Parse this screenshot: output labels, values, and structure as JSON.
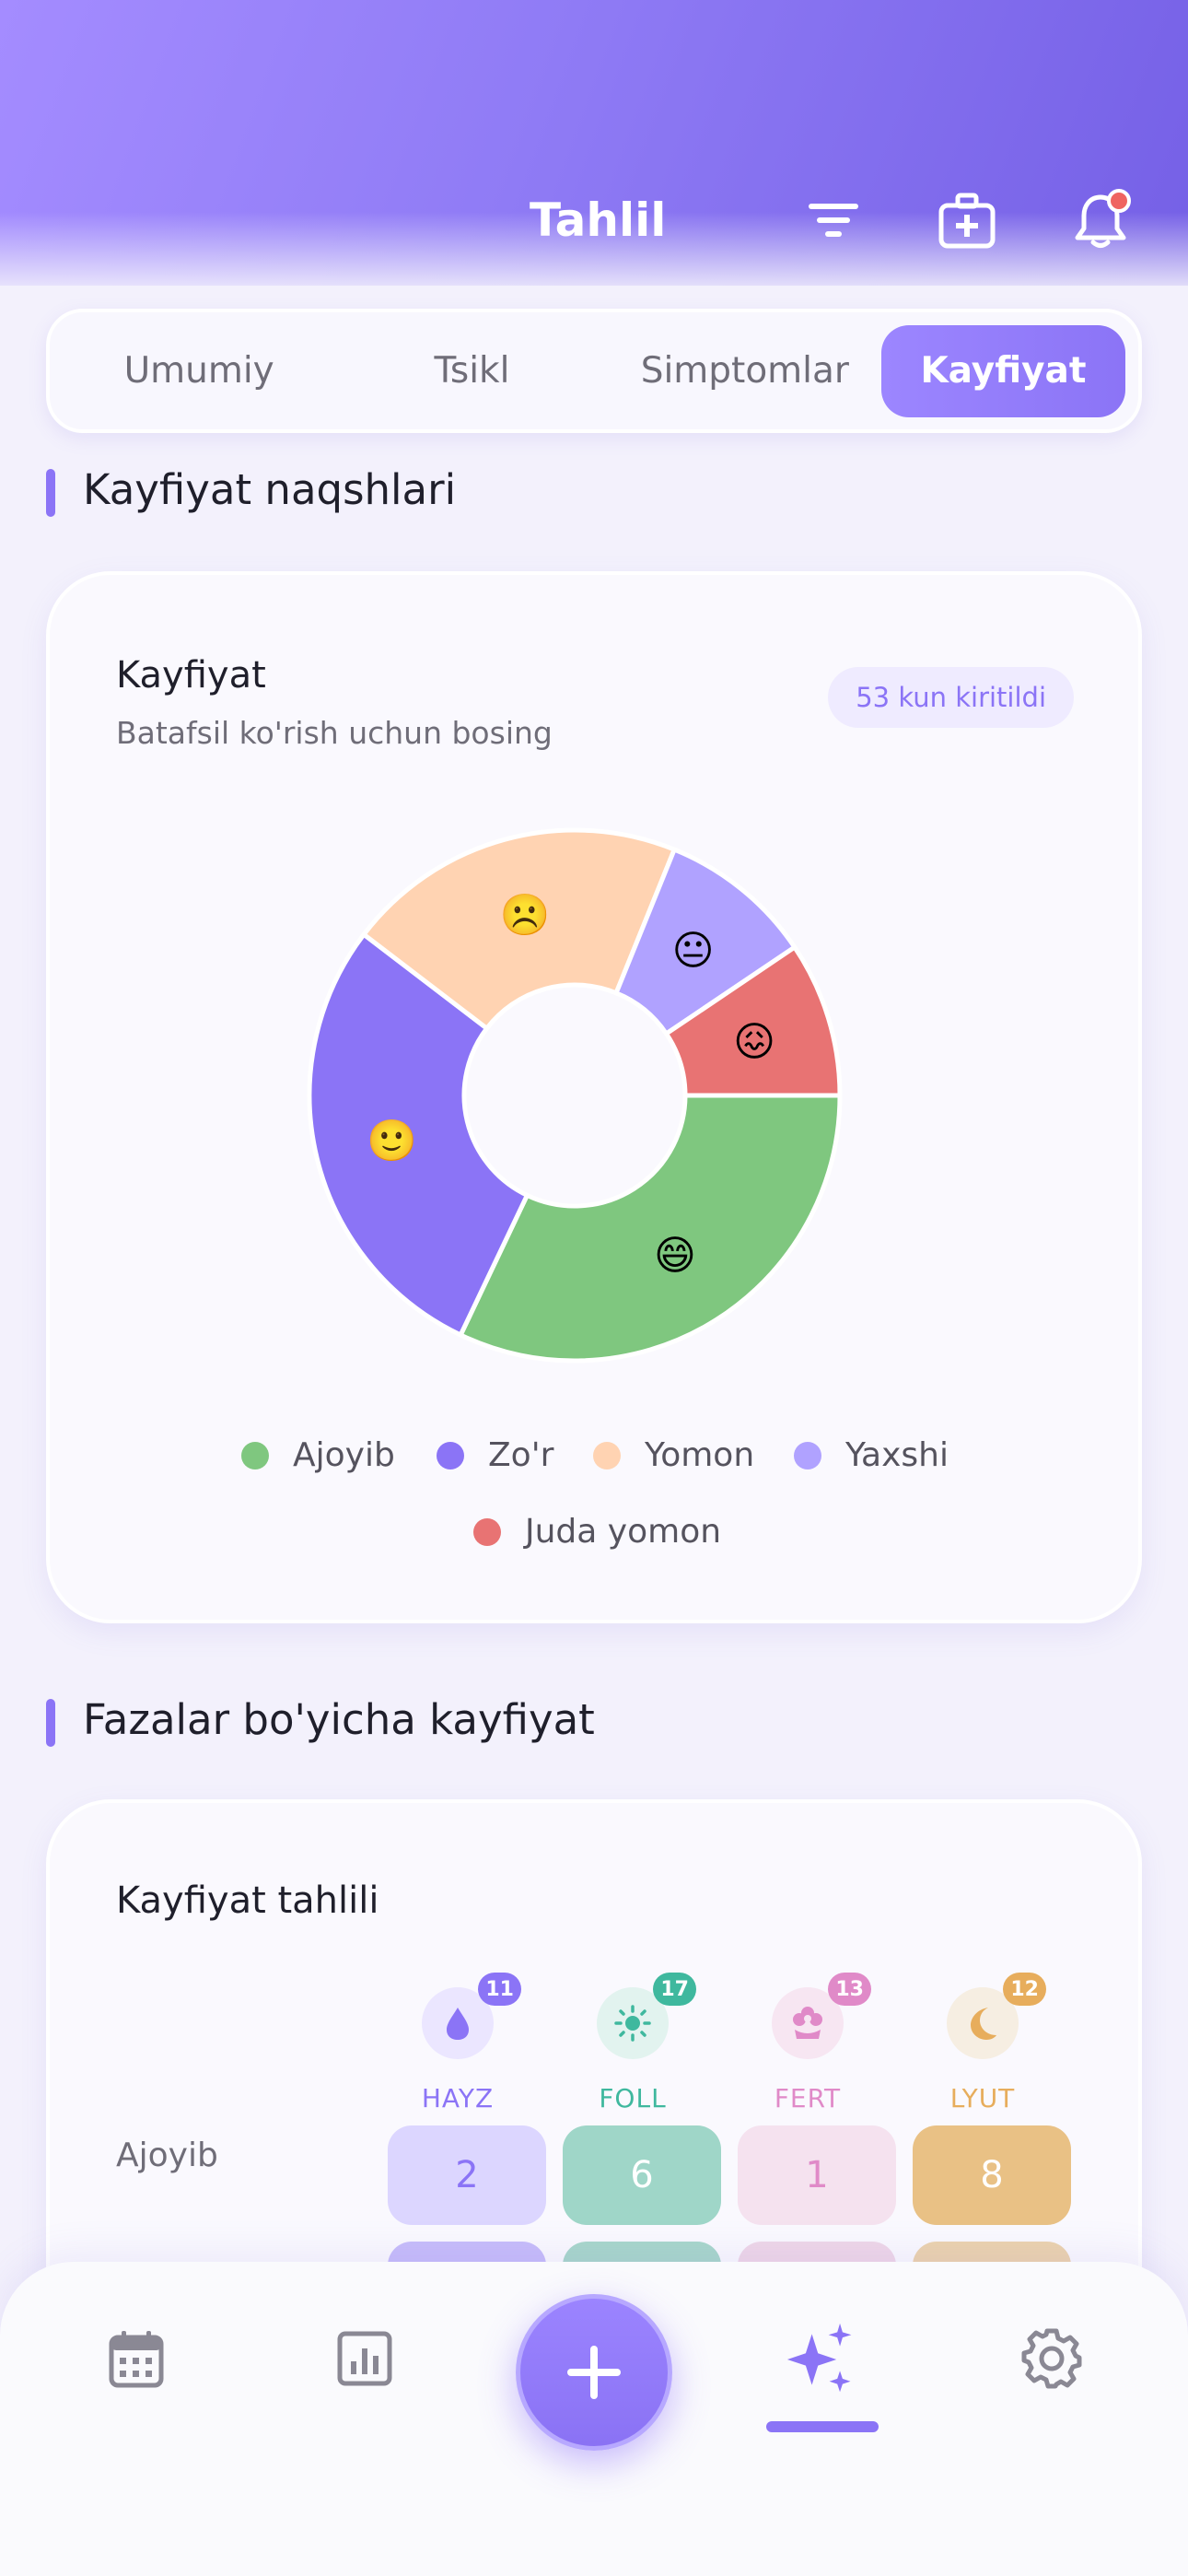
{
  "header": {
    "title": "Tahlil",
    "icons": [
      "filter-icon",
      "medical-kit-icon",
      "bell-icon"
    ]
  },
  "tabs": [
    {
      "label": "Umumiy",
      "active": false
    },
    {
      "label": "Tsikl",
      "active": false
    },
    {
      "label": "Simptomlar",
      "active": false
    },
    {
      "label": "Kayfiyat",
      "active": true
    }
  ],
  "mood_patterns": {
    "section_title": "Kayfiyat naqshlari",
    "card_title": "Kayfiyat",
    "card_subtitle": "Batafsil ko'rish uchun bosing",
    "badge": "53 kun kiritildi"
  },
  "chart_data": {
    "type": "pie",
    "donut": true,
    "title": "Kayfiyat",
    "categories": [
      "Ajoyib",
      "Zo'r",
      "Yomon",
      "Yaxshi",
      "Juda yomon"
    ],
    "values": [
      17,
      15,
      11,
      5,
      5
    ],
    "emoji": [
      "😄",
      "🙂",
      "☹️",
      "😐",
      "😖"
    ],
    "colors": [
      "#7fc77f",
      "#8b74f6",
      "#ffd3b2",
      "#b0a2ff",
      "#e87373"
    ],
    "legend_placement": "bottom"
  },
  "phase_mood": {
    "section_title": "Fazalar bo'yicha kayfiyat",
    "card_title": "Kayfiyat tahlili",
    "phases": [
      {
        "label": "HAYZ",
        "count": "11",
        "icon": "drop-icon",
        "color": "#8b74f6",
        "bg": "#ebe6ff"
      },
      {
        "label": "FOLL",
        "count": "17",
        "icon": "sun-icon",
        "color": "#3fb89e",
        "bg": "#e2f3ef"
      },
      {
        "label": "FERT",
        "count": "13",
        "icon": "flower-icon",
        "color": "#e08ac8",
        "bg": "#f7e6f2"
      },
      {
        "label": "LYUT",
        "count": "12",
        "icon": "moon-icon",
        "color": "#e7ad5c",
        "bg": "#f6eee2"
      }
    ],
    "rows": [
      {
        "label": "Ajoyib",
        "values": [
          "2",
          "6",
          "1",
          "8"
        ]
      }
    ]
  },
  "bottom_nav": {
    "items": [
      "calendar-icon",
      "chart-icon",
      "add-button",
      "sparkle-icon",
      "settings-icon"
    ],
    "active": "sparkle-icon"
  }
}
